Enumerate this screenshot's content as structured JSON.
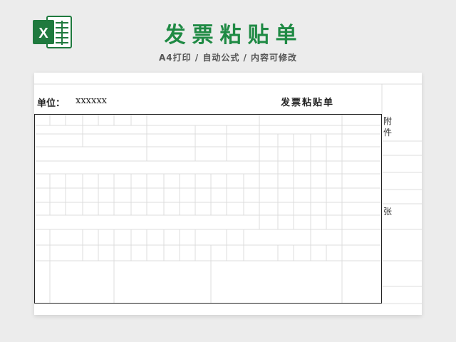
{
  "header": {
    "title": "发票粘贴单",
    "subtitle": "A4打印 / 自动公式 / 内容可修改",
    "logo_icon": "excel-icon",
    "logo_color": "#1f7a3e"
  },
  "sheet": {
    "org_label": "单位：",
    "org_value": "xxxxxx",
    "form_title": "发票粘贴单",
    "side_text_1": "附",
    "side_text_2": "件",
    "side_text_3": "张"
  }
}
